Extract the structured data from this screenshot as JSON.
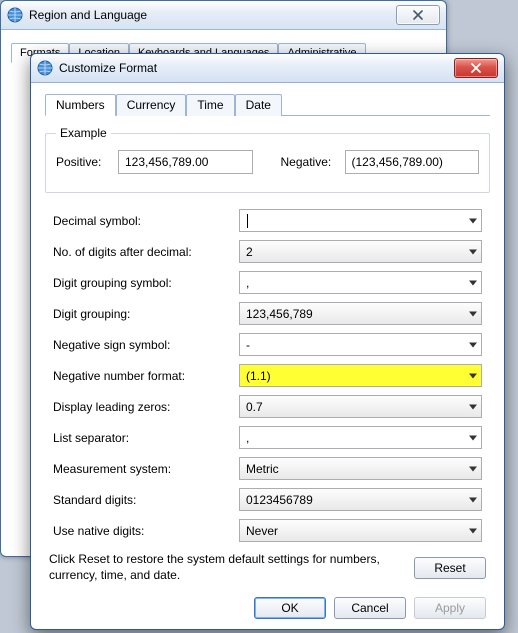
{
  "back": {
    "title": "Region and Language",
    "close_label": "✕",
    "tabs": [
      "Formats",
      "Location",
      "Keyboards and Languages",
      "Administrative"
    ],
    "active_tab": 0
  },
  "front": {
    "title": "Customize Format",
    "tabs": [
      "Numbers",
      "Currency",
      "Time",
      "Date"
    ],
    "active_tab": 0,
    "example": {
      "legend": "Example",
      "positive_label": "Positive:",
      "positive_value": "123,456,789.00",
      "negative_label": "Negative:",
      "negative_value": "(123,456,789.00)"
    },
    "rows": {
      "decimal_symbol": {
        "label": "Decimal symbol:",
        "value": "",
        "style": "flat",
        "has_cursor": true
      },
      "digits_after_decimal": {
        "label": "No. of digits after decimal:",
        "value": "2",
        "style": "grad"
      },
      "grouping_symbol": {
        "label": "Digit grouping symbol:",
        "value": ",",
        "style": "flat"
      },
      "digit_grouping": {
        "label": "Digit grouping:",
        "value": "123,456,789",
        "style": "grad"
      },
      "neg_sign": {
        "label": "Negative sign symbol:",
        "value": "-",
        "style": "flat"
      },
      "neg_format": {
        "label": "Negative number format:",
        "value": "(1.1)",
        "style": "highlight"
      },
      "leading_zeros": {
        "label": "Display leading zeros:",
        "value": "0.7",
        "style": "grad"
      },
      "list_sep": {
        "label": "List separator:",
        "value": ",",
        "style": "flat"
      },
      "measurement": {
        "label": "Measurement system:",
        "value": "Metric",
        "style": "grad"
      },
      "std_digits": {
        "label": "Standard digits:",
        "value": "0123456789",
        "style": "grad"
      },
      "native_digits": {
        "label": "Use native digits:",
        "value": "Never",
        "style": "grad"
      }
    },
    "reset": {
      "msg": "Click Reset to restore the system default settings for numbers, currency, time, and date.",
      "btn": "Reset"
    },
    "buttons": {
      "ok": "OK",
      "cancel": "Cancel",
      "apply": "Apply"
    }
  }
}
